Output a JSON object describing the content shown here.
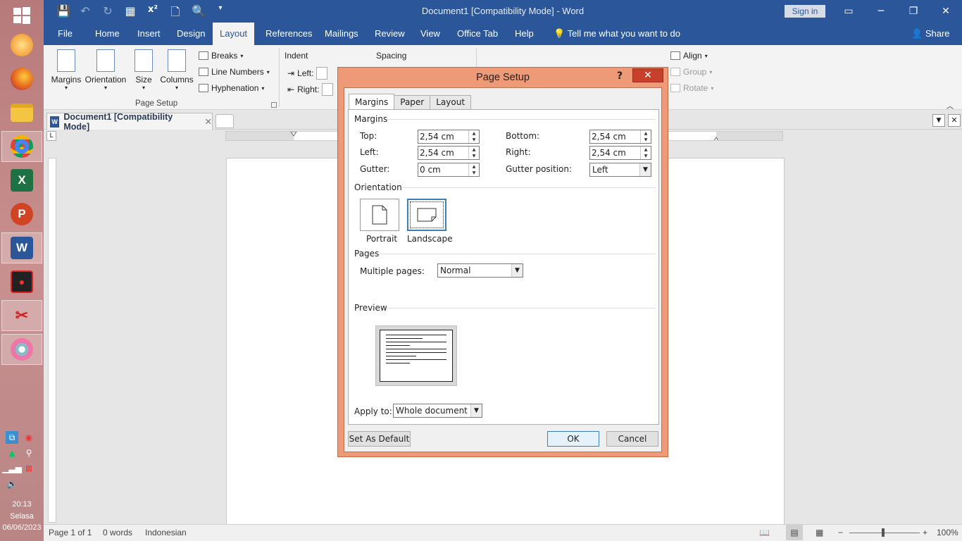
{
  "taskbar": {
    "time": "20:13",
    "day": "Selasa",
    "date": "06/06/2023"
  },
  "window": {
    "title": "Document1 [Compatibility Mode]  -  Word",
    "signin": "Sign in"
  },
  "ribbon_tabs": [
    "File",
    "Home",
    "Insert",
    "Design",
    "Layout",
    "References",
    "Mailings",
    "Review",
    "View",
    "Office Tab",
    "Help"
  ],
  "tell_me": "Tell me what you want to do",
  "share": "Share",
  "ribbon": {
    "margins": "Margins",
    "orientation": "Orientation",
    "size": "Size",
    "columns": "Columns",
    "breaks": "Breaks",
    "line_numbers": "Line Numbers",
    "hyphenation": "Hyphenation",
    "page_setup": "Page Setup",
    "indent": "Indent",
    "indent_left": "Left:",
    "indent_right": "Right:",
    "spacing": "Spacing",
    "align": "Align",
    "group": "Group",
    "rotate": "Rotate"
  },
  "doc_tab": "Document1 [Compatibility Mode]",
  "status": {
    "page": "Page 1 of 1",
    "words": "0 words",
    "language": "Indonesian",
    "zoom": "100%"
  },
  "dialog": {
    "title": "Page Setup",
    "help": "?",
    "tabs": [
      "Margins",
      "Paper",
      "Layout"
    ],
    "margins_section": "Margins",
    "top_label": "Top:",
    "top_value": "2,54 cm",
    "bottom_label": "Bottom:",
    "bottom_value": "2,54 cm",
    "left_label": "Left:",
    "left_value": "2,54 cm",
    "right_label": "Right:",
    "right_value": "2,54 cm",
    "gutter_label": "Gutter:",
    "gutter_value": "0 cm",
    "gutter_pos_label": "Gutter position:",
    "gutter_pos_value": "Left",
    "orientation_section": "Orientation",
    "portrait": "Portrait",
    "landscape": "Landscape",
    "pages_section": "Pages",
    "multiple_pages_label": "Multiple pages:",
    "multiple_pages_value": "Normal",
    "preview_section": "Preview",
    "apply_to_label": "Apply to:",
    "apply_to_value": "Whole document",
    "set_default": "Set As Default",
    "ok": "OK",
    "cancel": "Cancel"
  }
}
